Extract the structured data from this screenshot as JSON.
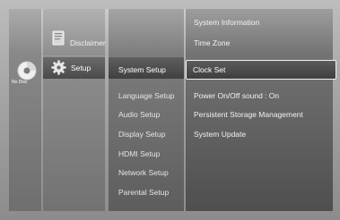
{
  "status": {
    "disc_label": "No Disc"
  },
  "main_menu": {
    "items": [
      {
        "label": "Disclaimer",
        "icon": "document-icon"
      },
      {
        "label": "Setup",
        "icon": "gear-icon",
        "selected": true
      }
    ]
  },
  "setup_menu": {
    "items": [
      "System Setup",
      "Language Setup",
      "Audio Setup",
      "Display Setup",
      "HDMI Setup",
      "Network Setup",
      "Parental Setup"
    ],
    "selected": "System Setup"
  },
  "system_setup": {
    "items": [
      {
        "label": "System Information"
      },
      {
        "label": "Time Zone"
      },
      {
        "label": "Clock Set",
        "selected": true
      },
      {
        "label": "Power On/Off sound",
        "value": ": On"
      },
      {
        "label": "Persistent Storage Management"
      },
      {
        "label": "System Update"
      }
    ]
  },
  "colors": {
    "background": "#a8a8a8",
    "highlight_border": "#f2f2f2",
    "text": "#f2f2f2"
  }
}
